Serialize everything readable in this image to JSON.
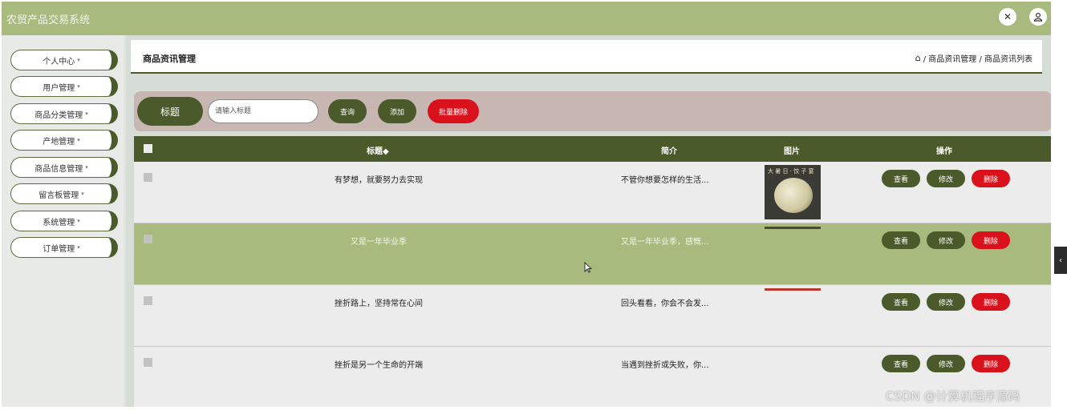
{
  "app": {
    "title": "农贸产品交易系统"
  },
  "header_icons": {
    "close_glyph": "✕",
    "user_glyph": "⛭"
  },
  "sidebar": {
    "items": [
      {
        "label": "个人中心"
      },
      {
        "label": "用户管理"
      },
      {
        "label": "商品分类管理"
      },
      {
        "label": "产地管理"
      },
      {
        "label": "商品信息管理"
      },
      {
        "label": "留言板管理"
      },
      {
        "label": "系统管理"
      },
      {
        "label": "订单管理"
      }
    ],
    "caret": "▾"
  },
  "page": {
    "title": "商品资讯管理",
    "breadcrumb": "/ 商品资讯管理 / 商品资讯列表",
    "home_glyph": "⌂"
  },
  "search": {
    "label": "标题",
    "placeholder": "请输入标题",
    "query_label": "查询",
    "add_label": "添加",
    "batch_delete_label": "批量删除"
  },
  "table": {
    "columns": {
      "title": "标题◆",
      "intro": "简介",
      "image": "图片",
      "actions": "操作"
    },
    "action_labels": {
      "view": "查看",
      "edit": "修改",
      "delete": "删除"
    },
    "rows": [
      {
        "title": "有梦想，就要努力去实现",
        "intro": "不管你想要怎样的生活...",
        "image_caption": "大 暑 日 · 饺 子 宴"
      },
      {
        "title": "又是一年毕业季",
        "intro": "又是一年毕业季，感慨..."
      },
      {
        "title": "挫折路上，坚持常在心间",
        "intro": "回头看看，你会不会发..."
      },
      {
        "title": "挫折是另一个生命的开端",
        "intro": "当遇到挫折或失败，你..."
      }
    ]
  },
  "collapse_glyph": "‹",
  "watermark": "CSDN @计算机程序源码",
  "colors": {
    "topbar": "#a8ba7e",
    "accent_dark": "#4a5a2a",
    "danger": "#d9111c",
    "highlight_row": "#a8ba7e",
    "search_bar": "#c8b6b3"
  }
}
